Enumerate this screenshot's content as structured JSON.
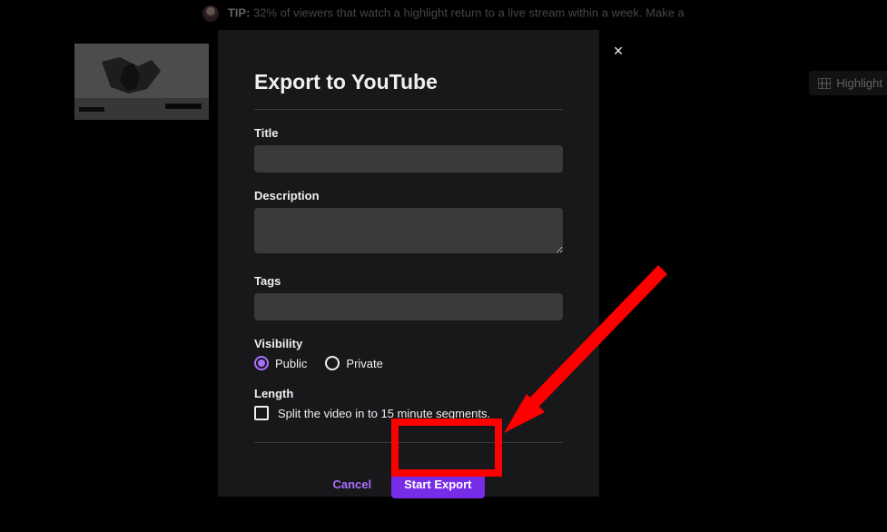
{
  "tip": {
    "label": "TIP:",
    "text": "32% of viewers that watch a highlight return to a live stream within a week. Make a"
  },
  "highlighterLabel": "Highlight",
  "closeIconName": "×",
  "modal": {
    "title": "Export to YouTube",
    "fields": {
      "titleLabel": "Title",
      "titleValue": "",
      "descriptionLabel": "Description",
      "descriptionValue": "",
      "tagsLabel": "Tags",
      "tagsValue": "",
      "visibilityLabel": "Visibility",
      "visibilityOptions": {
        "public": "Public",
        "private": "Private"
      },
      "lengthLabel": "Length",
      "splitLabel": "Split the video in to 15 minute segments."
    },
    "buttons": {
      "cancel": "Cancel",
      "startExport": "Start Export"
    }
  },
  "colors": {
    "accent": "#772ce8",
    "annotation": "#ff0000"
  }
}
